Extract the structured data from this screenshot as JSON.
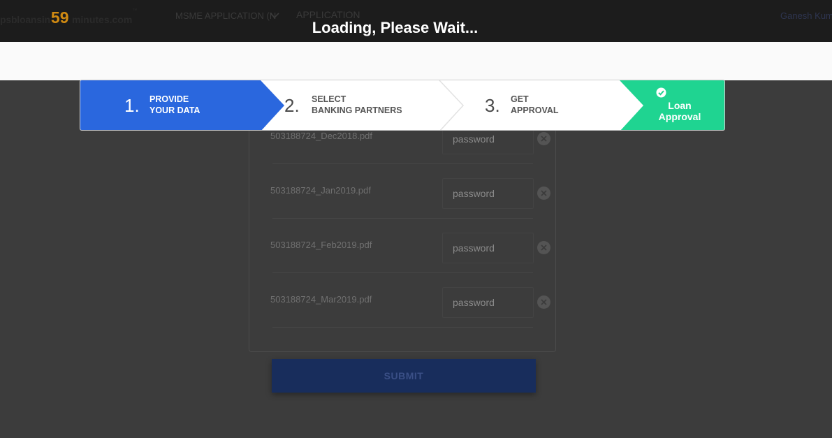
{
  "header": {
    "logo": {
      "prefix": "psbloansin",
      "number": "59",
      "suffix": "minutes.com",
      "tm": "™"
    },
    "nav": {
      "msme": "MSME APPLICATION (N",
      "application": "APPLICATION"
    },
    "user_name": "Ganesh Kum",
    "loading_text": "Loading, Please Wait..."
  },
  "stepper": {
    "steps": [
      {
        "number": "1.",
        "line1": "PROVIDE",
        "line2": "YOUR DATA",
        "state": "active"
      },
      {
        "number": "2.",
        "line1": "SELECT",
        "line2": "BANKING PARTNERS",
        "state": "pending"
      },
      {
        "number": "3.",
        "line1": "GET",
        "line2": "APPROVAL",
        "state": "pending"
      },
      {
        "number": "",
        "line1": "Loan",
        "line2": "Approval",
        "state": "complete"
      }
    ],
    "colors": {
      "active": "#2a67de",
      "complete": "#1fd491",
      "pending": "#ffffff"
    }
  },
  "files": [
    {
      "name": "503188724_Dec2018.pdf",
      "password": "",
      "placeholder": "password"
    },
    {
      "name": "503188724_Jan2019.pdf",
      "password": "",
      "placeholder": "password"
    },
    {
      "name": "503188724_Feb2019.pdf",
      "password": "",
      "placeholder": "password"
    },
    {
      "name": "503188724_Mar2019.pdf",
      "password": "",
      "placeholder": "password"
    }
  ],
  "submit_label": "SUBMIT"
}
